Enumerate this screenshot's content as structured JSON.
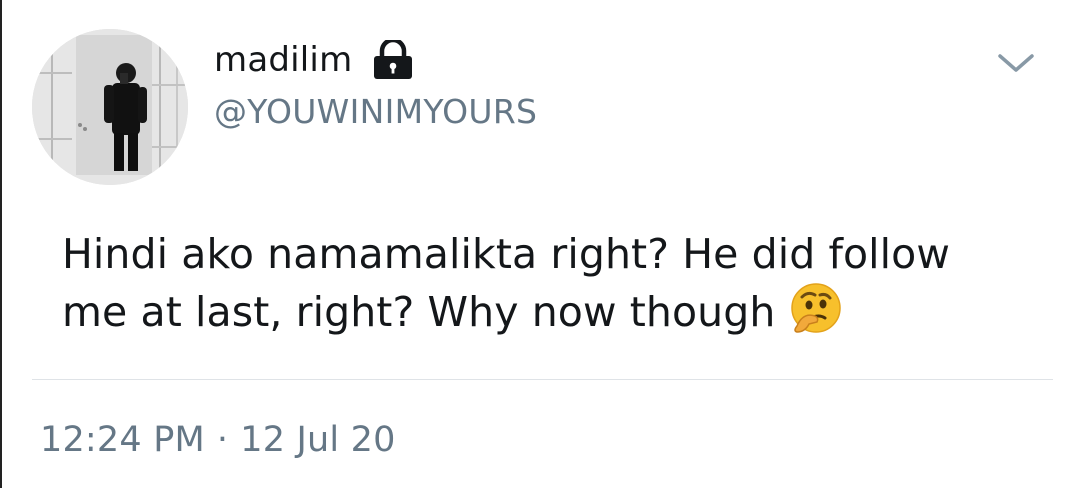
{
  "tweet": {
    "author": {
      "display_name": "madilim",
      "handle": "@YOUWINIMYOURS",
      "protected_icon": "lock-icon",
      "avatar_icon": "profile-photo"
    },
    "text_lines": [
      "Hindi ako namamalikta right? He did follow",
      "me at last, right? Why now though"
    ],
    "emoji": "thinking-face-emoji",
    "time": "12:24 PM",
    "separator": "·",
    "date": "12 Jul 20",
    "menu_icon": "chevron-down-icon"
  },
  "colors": {
    "text_primary": "#14171a",
    "text_secondary": "#657786",
    "divider": "#dfe3e7",
    "emoji_yellow": "#f7c02c"
  }
}
